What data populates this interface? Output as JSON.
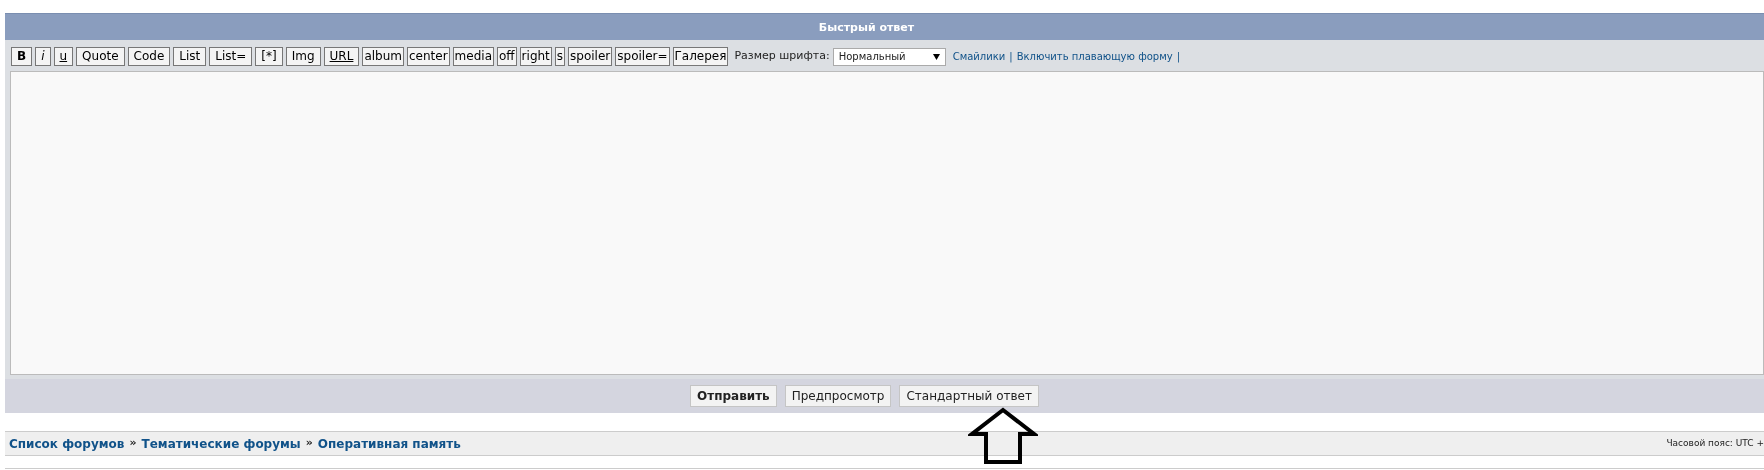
{
  "panel": {
    "title": "Быстрый ответ"
  },
  "toolbar": {
    "buttons": [
      {
        "label": "B",
        "kind": "bold"
      },
      {
        "label": "i",
        "kind": "italic"
      },
      {
        "label": "u",
        "kind": "underline"
      },
      {
        "label": "Quote",
        "kind": "plain"
      },
      {
        "label": "Code",
        "kind": "plain"
      },
      {
        "label": "List",
        "kind": "plain"
      },
      {
        "label": "List=",
        "kind": "plain"
      },
      {
        "label": "[*]",
        "kind": "plain"
      },
      {
        "label": "Img",
        "kind": "plain"
      },
      {
        "label": "URL",
        "kind": "underline"
      },
      {
        "label": "album",
        "kind": "custom"
      },
      {
        "label": "center",
        "kind": "custom"
      },
      {
        "label": "media",
        "kind": "custom"
      },
      {
        "label": "off",
        "kind": "custom"
      },
      {
        "label": "right",
        "kind": "custom"
      },
      {
        "label": "s",
        "kind": "custom"
      },
      {
        "label": "spoiler",
        "kind": "custom"
      },
      {
        "label": "spoiler=",
        "kind": "custom"
      },
      {
        "label": "Галерея",
        "kind": "custom"
      }
    ],
    "font_size_label": "Размер шрифта:",
    "font_size_value": "Нормальный",
    "links": [
      "Смайлики",
      "Включить плавающую форму"
    ],
    "separator": "|"
  },
  "actions": [
    {
      "label": "Отправить",
      "primary": true
    },
    {
      "label": "Предпросмотр",
      "primary": false
    },
    {
      "label": "Стандартный ответ",
      "primary": false
    }
  ],
  "breadcrumbs": {
    "items": [
      "Список форумов",
      "Тематические форумы",
      "Оперативная память"
    ],
    "separator": "»"
  },
  "timezone": "Часовой пояс: UTC +"
}
